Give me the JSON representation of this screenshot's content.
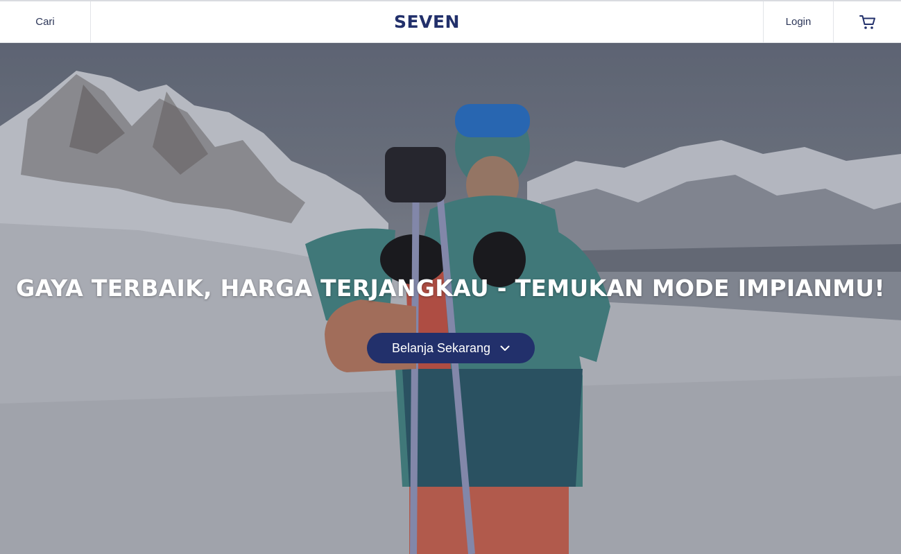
{
  "header": {
    "search_label": "Cari",
    "logo_text": "SEVEN",
    "login_label": "Login",
    "cart_icon": "cart-icon"
  },
  "hero": {
    "title": "GAYA TERBAIK, HARGA TERJANGKAU - TEMUKAN MODE IMPIANMU!",
    "cta_label": "Belanja Sekarang",
    "cta_icon": "chevron-down-icon"
  },
  "colors": {
    "brand": "#22306b",
    "header_bg": "#ffffff",
    "text_on_hero": "#ffffff"
  }
}
